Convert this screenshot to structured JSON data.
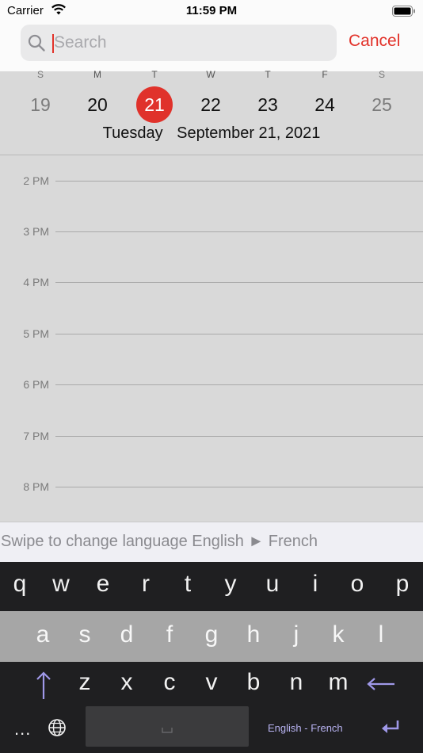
{
  "status_bar": {
    "carrier": "Carrier",
    "time": "11:59 PM",
    "icons": [
      "wifi-icon",
      "battery-icon"
    ]
  },
  "search": {
    "placeholder": "Search",
    "value": "",
    "cancel_label": "Cancel",
    "icon": "search-icon"
  },
  "week": {
    "weekday_letters": [
      "S",
      "M",
      "T",
      "W",
      "T",
      "F",
      "S"
    ],
    "days": [
      "19",
      "20",
      "21",
      "22",
      "23",
      "24",
      "25"
    ],
    "selected_day": "21",
    "selected_weekday": "Tuesday",
    "selected_date": "September 21, 2021"
  },
  "timeline": {
    "hours": [
      "2 PM",
      "3 PM",
      "4 PM",
      "5 PM",
      "6 PM",
      "7 PM",
      "8 PM"
    ]
  },
  "language_hint": "Swipe to change language English ► French",
  "keyboard": {
    "row1": [
      "q",
      "w",
      "e",
      "r",
      "t",
      "y",
      "u",
      "i",
      "o",
      "p"
    ],
    "row2": [
      "a",
      "s",
      "d",
      "f",
      "g",
      "h",
      "j",
      "k",
      "l"
    ],
    "row3": [
      "z",
      "x",
      "c",
      "v",
      "b",
      "n",
      "m"
    ],
    "more_label": "...",
    "language_label": "English - French",
    "icons": [
      "shift-icon",
      "backspace-icon",
      "globe-icon",
      "space-icon",
      "return-icon"
    ]
  },
  "colors": {
    "accent": "#e2322a",
    "keyboard_dark": "#1f1f21",
    "keyboard_mid": "#a6a6a6",
    "keyboard_accent": "#b8b3f2"
  }
}
